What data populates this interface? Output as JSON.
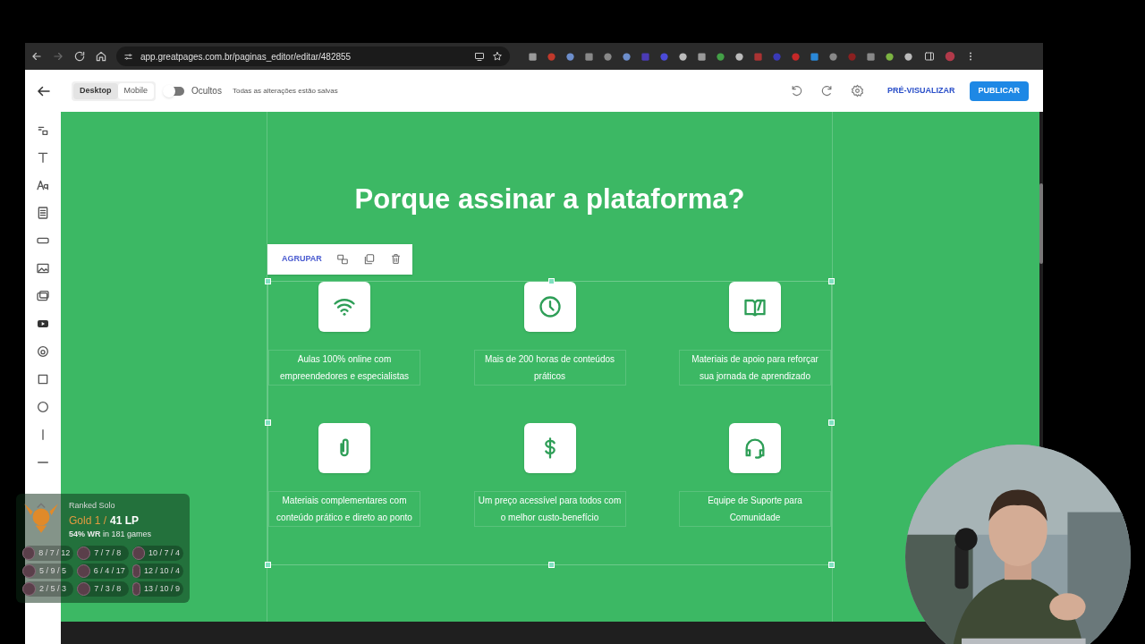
{
  "browser": {
    "url": "app.greatpages.com.br/paginas_editor/editar/482855"
  },
  "editor_header": {
    "view_tabs": [
      {
        "label": "Desktop",
        "selected": true
      },
      {
        "label": "Mobile",
        "selected": false
      }
    ],
    "hidden_toggle": {
      "label": "Ocultos",
      "on": false
    },
    "save_status": "Todas as alterações estão salvas",
    "preview_button": "PRÉ-VISUALIZAR",
    "publish_button": "PUBLICAR"
  },
  "canvas": {
    "heading": "Porque assinar a plataforma?",
    "selection_toolbar": {
      "label": "AGRUPAR"
    },
    "features": [
      {
        "kind": "wifi",
        "text": "Aulas 100% online com empreendedores e especialistas"
      },
      {
        "kind": "clock",
        "text": "Mais de 200 horas de conteúdos práticos"
      },
      {
        "kind": "book",
        "text": "Materiais de apoio para reforçar sua jornada de aprendizado"
      },
      {
        "kind": "clip",
        "text": "Materiais complementares com conteúdo prático e direto ao ponto"
      },
      {
        "kind": "dollar",
        "text": "Um preço acessível para todos com o melhor custo-benefício"
      },
      {
        "kind": "headset",
        "text": "Equipe de Suporte para Comunidade"
      }
    ]
  },
  "rank_overlay": {
    "queue": "Ranked Solo",
    "rank": "Gold 1 /",
    "lp": "41 LP",
    "winrate": "**54% WR** in 181 games",
    "matches": [
      [
        "8 / 7 / 12",
        "7 / 7 / 8",
        "10 / 7 / 4"
      ],
      [
        "5 / 9 / 5",
        "6 / 4 / 17",
        "12 / 10 / 4"
      ],
      [
        "2 / 5 / 3",
        "7 / 3 / 8",
        "13 / 10 / 9"
      ]
    ]
  }
}
